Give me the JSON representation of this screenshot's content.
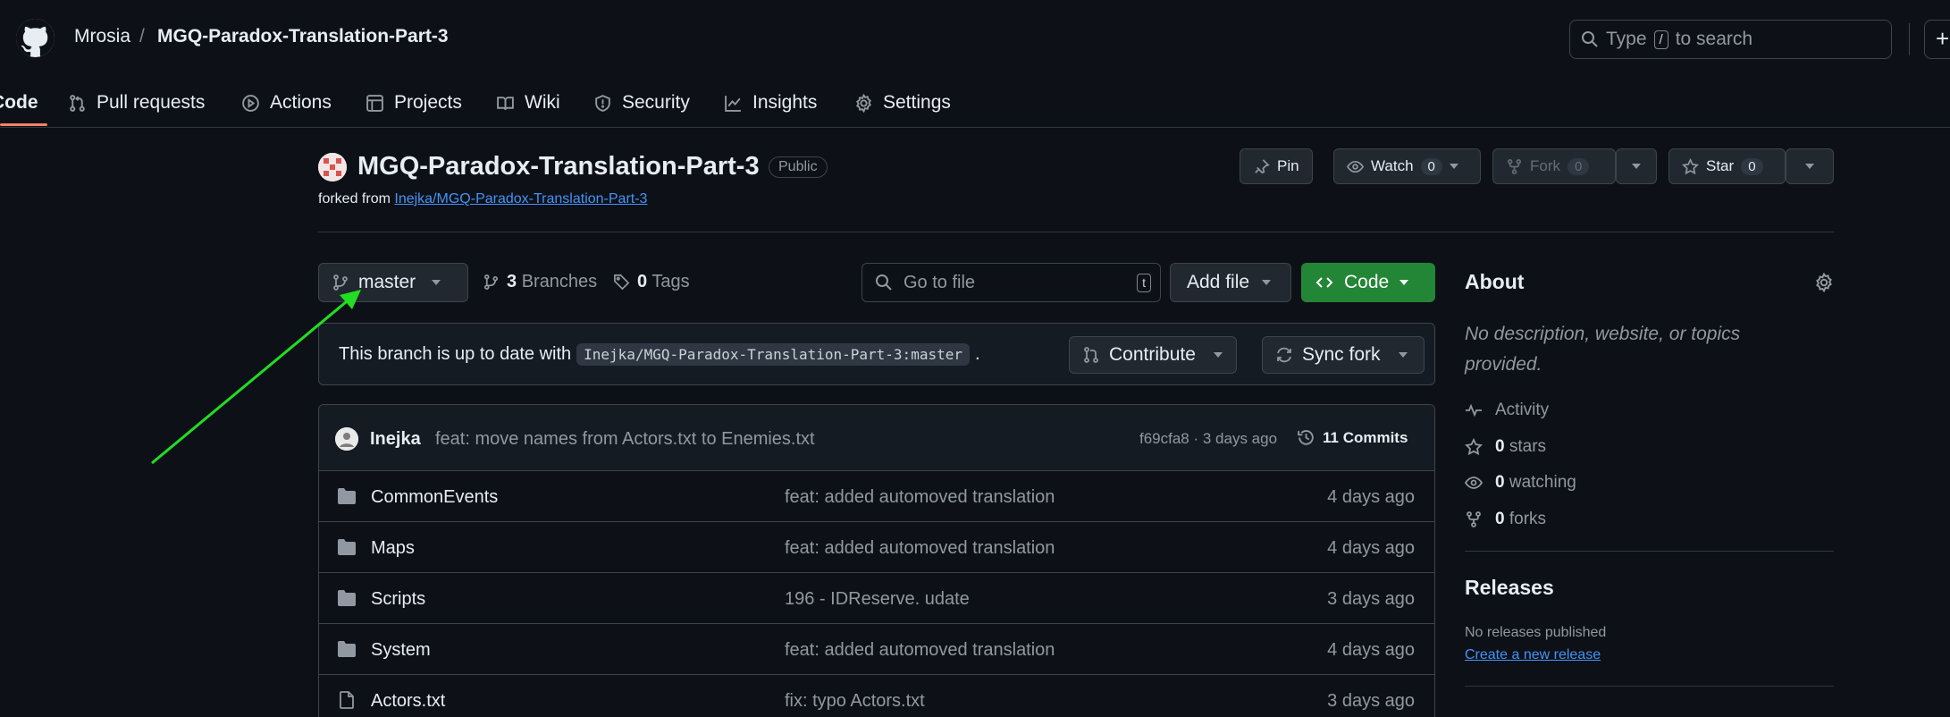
{
  "header": {
    "logo_icon": "github-logo-icon",
    "owner": "Mrosia",
    "separator": "/",
    "repo": "MGQ-Paradox-Translation-Part-3",
    "search_prefix": "Type",
    "search_key": "/",
    "search_suffix": "to search",
    "plus_label": "+"
  },
  "tabs": [
    {
      "label": "Code",
      "icon": "code-icon"
    },
    {
      "label": "Pull requests",
      "icon": "pull-request-icon"
    },
    {
      "label": "Actions",
      "icon": "play-icon"
    },
    {
      "label": "Projects",
      "icon": "table-icon"
    },
    {
      "label": "Wiki",
      "icon": "book-icon"
    },
    {
      "label": "Security",
      "icon": "shield-icon"
    },
    {
      "label": "Insights",
      "icon": "graph-icon"
    },
    {
      "label": "Settings",
      "icon": "gear-icon"
    }
  ],
  "repo": {
    "title": "MGQ-Paradox-Translation-Part-3",
    "visibility": "Public",
    "forked_prefix": "forked from",
    "forked_from": "Inejka/MGQ-Paradox-Translation-Part-3",
    "pin_label": "Pin",
    "watch_label": "Watch",
    "watch_count": "0",
    "fork_label": "Fork",
    "fork_count": "0",
    "star_label": "Star",
    "star_count": "0"
  },
  "controls": {
    "branch": "master",
    "branches_count": "3",
    "branches_label": "Branches",
    "tags_count": "0",
    "tags_label": "Tags",
    "go_to_file": "Go to file",
    "go_to_file_key": "t",
    "add_file": "Add file",
    "code_label": "Code"
  },
  "sync": {
    "text": "This branch is up to date with",
    "branch_ref": "Inejka/MGQ-Paradox-Translation-Part-3:master",
    "period": ".",
    "contribute_label": "Contribute",
    "sync_label": "Sync fork"
  },
  "commit": {
    "author": "Inejka",
    "message": "feat: move names from Actors.txt to Enemies.txt",
    "hash_time": "f69cfa8 · 3 days ago",
    "count_label": "11 Commits"
  },
  "files": [
    {
      "type": "folder",
      "name": "CommonEvents",
      "message": "feat: added automoved translation",
      "date": "4 days ago"
    },
    {
      "type": "folder",
      "name": "Maps",
      "message": "feat: added automoved translation",
      "date": "4 days ago"
    },
    {
      "type": "folder",
      "name": "Scripts",
      "message": "196 - IDReserve. udate",
      "date": "3 days ago"
    },
    {
      "type": "folder",
      "name": "System",
      "message": "feat: added automoved translation",
      "date": "4 days ago"
    },
    {
      "type": "file",
      "name": "Actors.txt",
      "message": "fix: typo Actors.txt",
      "date": "3 days ago"
    }
  ],
  "about": {
    "title": "About",
    "description": "No description, website, or topics provided.",
    "activity": "Activity",
    "stars_count": "0",
    "stars_label": "stars",
    "watching_count": "0",
    "watching_label": "watching",
    "forks_count": "0",
    "forks_label": "forks",
    "releases_title": "Releases",
    "no_releases": "No releases published",
    "create_release": "Create a new release"
  },
  "colors": {
    "background": "#0d1117",
    "accent_green": "#238636",
    "link_blue": "#4493f8",
    "annotation_arrow": "#22dd22",
    "tab_underline": "#f78166"
  }
}
